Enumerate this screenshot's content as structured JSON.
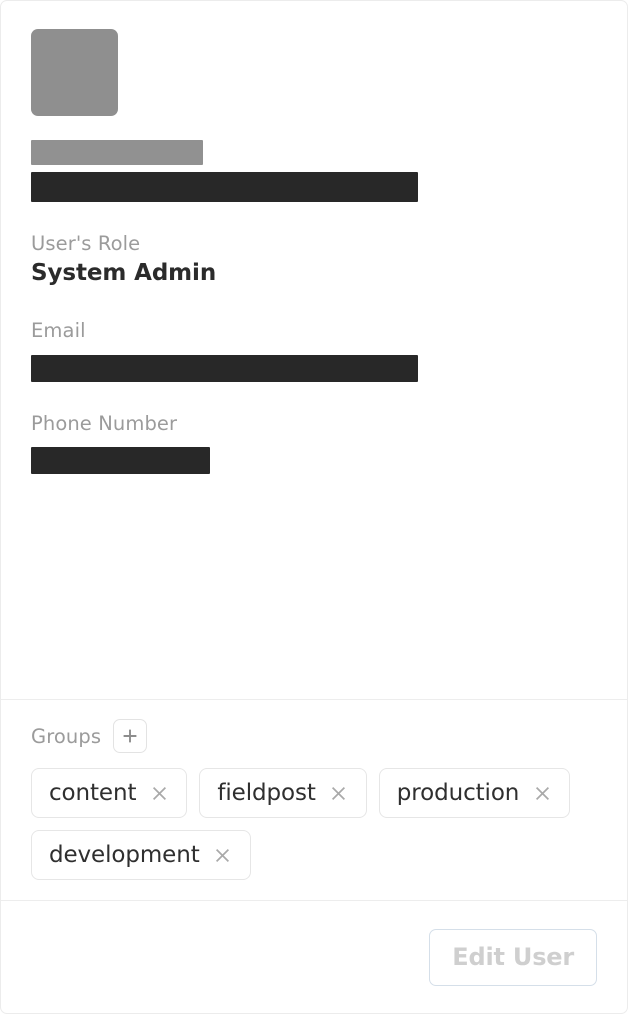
{
  "card": {
    "avatar": {
      "name": "user-avatar-placeholder"
    },
    "redactions": {
      "name_bar": "",
      "username_bar": "",
      "email_bar": "",
      "phone_bar": ""
    },
    "fields": [
      {
        "label": "User's Role",
        "value": "System Admin"
      },
      {
        "label": "Email",
        "value": ""
      },
      {
        "label": "Phone Number",
        "value": ""
      }
    ],
    "groups": {
      "label": "Groups",
      "add_icon": "plus-icon",
      "add_label": "+",
      "remove_icon": "close-icon",
      "chips": [
        {
          "label": "content"
        },
        {
          "label": "fieldpost"
        },
        {
          "label": "production"
        },
        {
          "label": "development"
        }
      ]
    },
    "footer": {
      "edit_button_label": "Edit User"
    },
    "colors": {
      "avatar": "#8f8f8f",
      "redaction_dark": "#282828",
      "redaction_light": "#919191",
      "label_text": "#9b9b9b",
      "value_text": "#2b2b2b",
      "chip_border": "#e6e6e6",
      "divider": "#ededed",
      "edit_button_border": "#d5dfe9",
      "edit_button_text": "#cfcfcf"
    }
  }
}
